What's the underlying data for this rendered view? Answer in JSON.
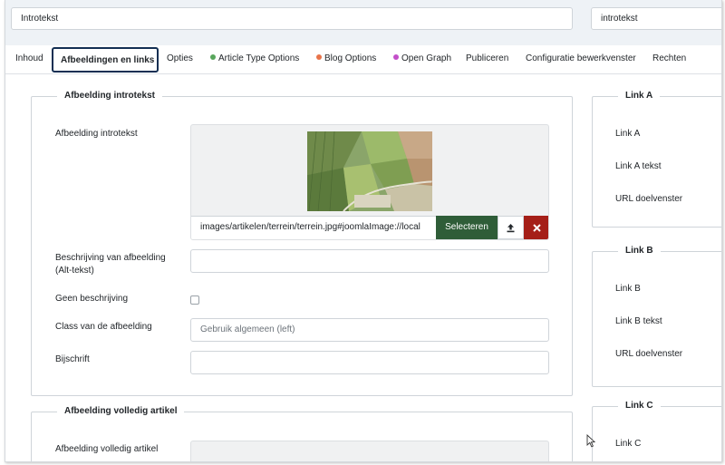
{
  "top_fields": {
    "left_value": "Introtekst",
    "right_value": "introtekst"
  },
  "tabs": [
    {
      "label": "Inhoud"
    },
    {
      "label": "Afbeeldingen en links"
    },
    {
      "label": "Opties"
    },
    {
      "label": "Article Type Options",
      "dot_color": "#58a65c"
    },
    {
      "label": "Blog Options",
      "dot_color": "#e8734a"
    },
    {
      "label": "Open Graph",
      "dot_color": "#c34fc9"
    },
    {
      "label": "Publiceren"
    },
    {
      "label": "Configuratie bewerkvenster"
    },
    {
      "label": "Rechten"
    }
  ],
  "intro_image": {
    "legend": "Afbeelding introtekst",
    "image_label": "Afbeelding introtekst",
    "image_path": "images/artikelen/terrein/terrein.jpg#joomlaImage://local",
    "select_label": "Selecteren",
    "alt_label": "Beschrijving van afbeelding (Alt-tekst)",
    "alt_value": "",
    "no_desc_label": "Geen beschrijving",
    "class_label": "Class van de afbeelding",
    "class_placeholder": "Gebruik algemeen (left)",
    "caption_label": "Bijschrift",
    "caption_value": ""
  },
  "full_image": {
    "legend": "Afbeelding volledig artikel",
    "image_label": "Afbeelding volledig artikel"
  },
  "link_a": {
    "legend": "Link A",
    "link_label": "Link A",
    "text_label": "Link A tekst",
    "target_label": "URL doelvenster"
  },
  "link_b": {
    "legend": "Link B",
    "link_label": "Link B",
    "text_label": "Link B tekst",
    "target_label": "URL doelvenster"
  },
  "link_c": {
    "legend": "Link C",
    "link_label": "Link C"
  },
  "colors": {
    "active_tab_border": "#132f53",
    "select_button": "#2f5d38",
    "remove_button": "#a51f18"
  }
}
